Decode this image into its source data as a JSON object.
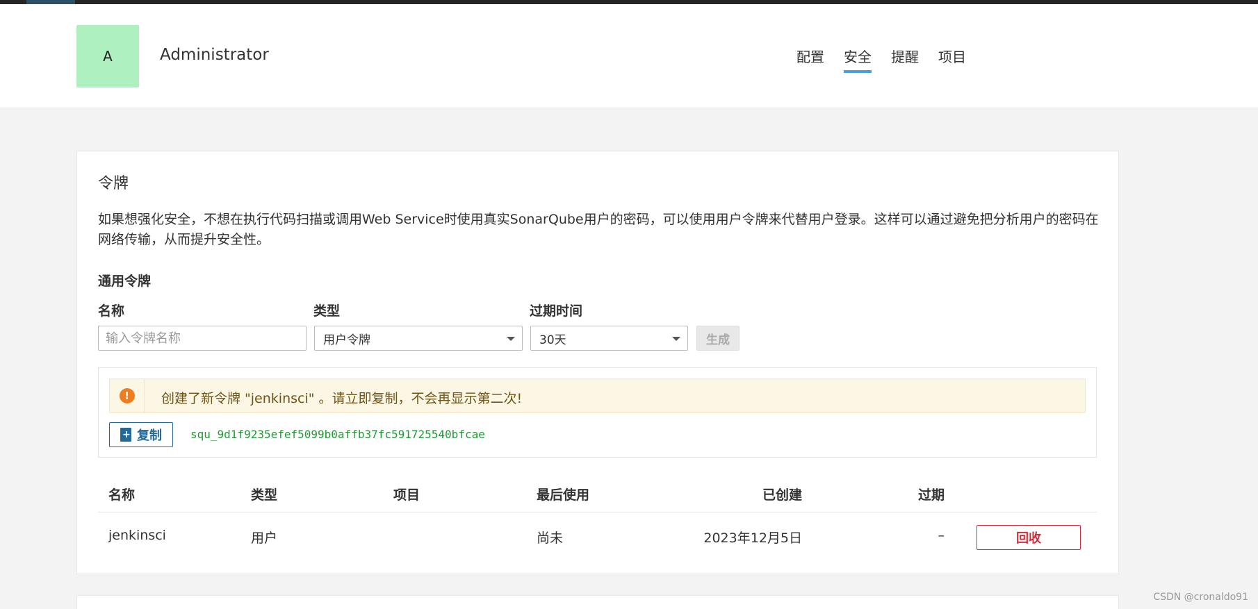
{
  "header": {
    "avatar_letter": "A",
    "user_name": "Administrator",
    "nav": [
      "配置",
      "安全",
      "提醒",
      "项目"
    ],
    "active_nav": "安全"
  },
  "tokens": {
    "title": "令牌",
    "description": "如果想强化安全，不想在执行代码扫描或调用Web Service时使用真实SonarQube用户的密码，可以使用用户令牌来代替用户登录。这样可以通过避免把分析用户的密码在网络传输，从而提升安全性。",
    "section_title": "通用令牌",
    "form": {
      "name_label": "名称",
      "name_placeholder": "输入令牌名称",
      "type_label": "类型",
      "type_value": "用户令牌",
      "expiry_label": "过期时间",
      "expiry_value": "30天",
      "generate_label": "生成"
    },
    "new_token": {
      "alert_text": "创建了新令牌 \"jenkinsci\" 。请立即复制，不会再显示第二次!",
      "copy_label": "复制",
      "value": "squ_9d1f9235efef5099b0affb37fc591725540bfcae"
    },
    "table": {
      "headers": {
        "name": "名称",
        "type": "类型",
        "project": "项目",
        "last_used": "最后使用",
        "created": "已创建",
        "expires": "过期"
      },
      "rows": [
        {
          "name": "jenkinsci",
          "type": "用户",
          "project": "",
          "last_used": "尚未",
          "created": "2023年12月5日",
          "expires": "–",
          "revoke_label": "回收"
        }
      ]
    }
  },
  "colors": {
    "avatar_bg": "#aef0c0",
    "active_tab_underline": "#4b9fd5",
    "alert_icon": "#ed7d20",
    "copy_button": "#236a97",
    "token_text": "#1f9a33",
    "revoke_button": "#d02f3a"
  },
  "watermark": "CSDN @cronaldo91"
}
